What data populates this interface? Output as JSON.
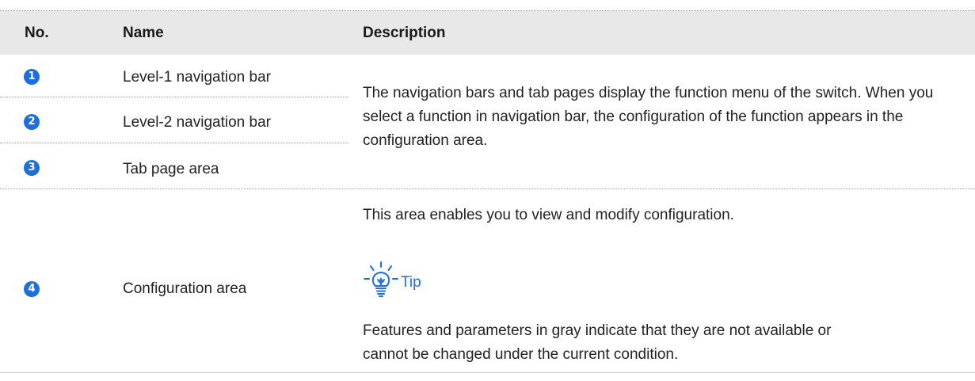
{
  "columns": {
    "no": "No.",
    "name": "Name",
    "description": "Description"
  },
  "rows": [
    {
      "number": "1",
      "name": "Level-1 navigation bar"
    },
    {
      "number": "2",
      "name": "Level-2 navigation bar"
    },
    {
      "number": "3",
      "name": "Tab page area"
    },
    {
      "number": "4",
      "name": "Configuration area"
    }
  ],
  "descriptions": {
    "navigation": "The navigation bars and tab pages display the function menu of the switch. When you select a function in navigation bar, the configuration of the function appears in the configuration area.",
    "configuration": "This area enables you to view and modify configuration.",
    "tip_label": "Tip",
    "tip_text": "Features and parameters in gray indicate that they are not available or cannot be changed under the current condition."
  },
  "colors": {
    "badge": "#1e6ee0",
    "tip": "#1e6ee0",
    "header_bg": "#e8e8e8"
  },
  "icons": {
    "tip": "lightbulb-icon"
  }
}
